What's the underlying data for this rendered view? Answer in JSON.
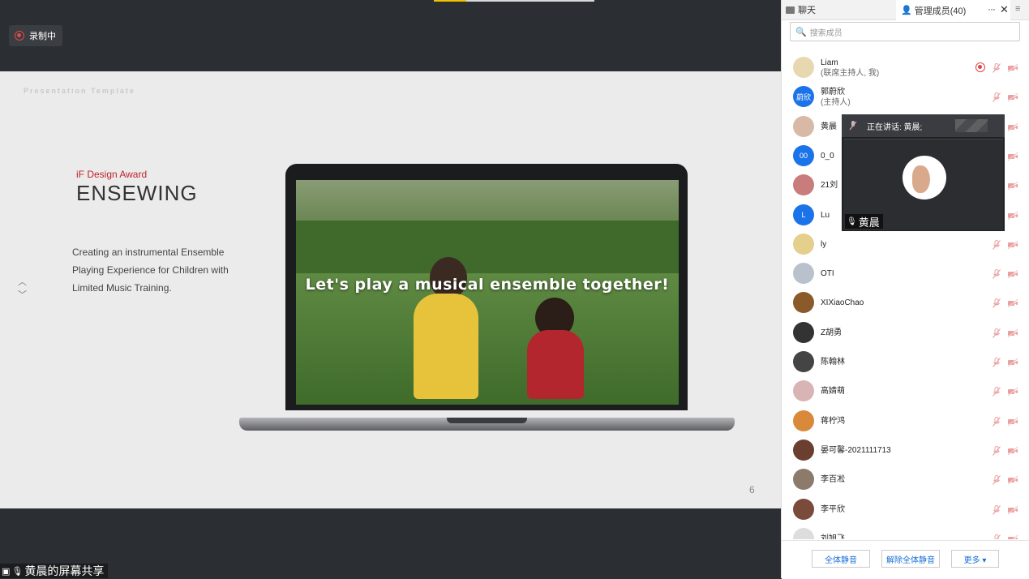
{
  "recording": {
    "label": "录制中"
  },
  "slide": {
    "template_label": "Presentation Template",
    "award": "iF Design Award",
    "brand": "ENSEWING",
    "description": "Creating an instrumental Ensemble Playing Experience for Children with Limited Music Training.",
    "screen_text": "Let's play a musical ensemble together!",
    "page_number": "6"
  },
  "share_label": "黄晨的屏幕共享",
  "panel": {
    "tabs": {
      "chat": "聊天",
      "members": "管理成员(40)"
    },
    "search_placeholder": "搜索成员",
    "members": [
      {
        "name": "Liam",
        "sub": "(联席主持人, 我)",
        "avatar_text": "",
        "avatar_color": "#e8d8b0",
        "recording": true
      },
      {
        "name": "郭蔚欣",
        "sub": "(主持人)",
        "avatar_text": "蔚欣",
        "avatar_color": "#1a73e8"
      },
      {
        "name": "黄晨",
        "sub": "",
        "avatar_text": "",
        "avatar_color": "#d8b9a5"
      },
      {
        "name": "0_0",
        "sub": "",
        "avatar_text": "00",
        "avatar_color": "#1a73e8"
      },
      {
        "name": "21刘",
        "sub": "",
        "avatar_text": "",
        "avatar_color": "#c97c7c"
      },
      {
        "name": "Lu",
        "sub": "",
        "avatar_text": "L",
        "avatar_color": "#1a73e8"
      },
      {
        "name": "ly",
        "sub": "",
        "avatar_text": "",
        "avatar_color": "#e5cf8c"
      },
      {
        "name": "OTI",
        "sub": "",
        "avatar_text": "",
        "avatar_color": "#b9c2cc"
      },
      {
        "name": "XIXiaoChao",
        "sub": "",
        "avatar_text": "",
        "avatar_color": "#8a5a2b"
      },
      {
        "name": "Z胡勇",
        "sub": "",
        "avatar_text": "",
        "avatar_color": "#333333"
      },
      {
        "name": "陈翰林",
        "sub": "",
        "avatar_text": "",
        "avatar_color": "#444444"
      },
      {
        "name": "高婧萌",
        "sub": "",
        "avatar_text": "",
        "avatar_color": "#d9b4b4"
      },
      {
        "name": "蒋柠鸿",
        "sub": "",
        "avatar_text": "",
        "avatar_color": "#d9893a"
      },
      {
        "name": "晏可馨-2021111713",
        "sub": "",
        "avatar_text": "",
        "avatar_color": "#6b3f2f"
      },
      {
        "name": "李百凇",
        "sub": "",
        "avatar_text": "",
        "avatar_color": "#8c7b6b"
      },
      {
        "name": "李平欣",
        "sub": "",
        "avatar_text": "",
        "avatar_color": "#7a4a3a"
      },
      {
        "name": "刘旭飞",
        "sub": "",
        "avatar_text": "",
        "avatar_color": "#dddddd"
      }
    ],
    "footer": {
      "mute_all": "全体静音",
      "unmute_all": "解除全体静音",
      "more": "更多 ▾"
    }
  },
  "speaker_popup": {
    "label": "正在讲话: 黄晨;",
    "name": "黄晨"
  },
  "colors": {
    "accent_blue": "#1a73e8",
    "recording_red": "#e34343",
    "muted_red": "#e9a0a0"
  }
}
